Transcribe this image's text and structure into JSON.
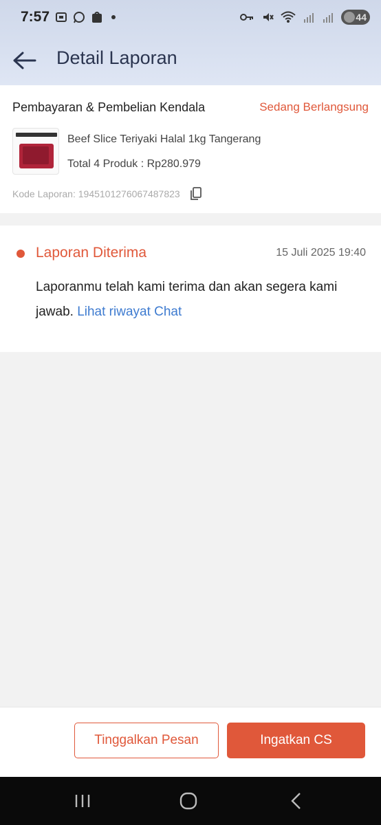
{
  "status_bar": {
    "time": "7:57",
    "battery": "44"
  },
  "header": {
    "title": "Detail Laporan"
  },
  "report": {
    "category": "Pembayaran & Pembelian Kendala",
    "status": "Sedang Berlangsung",
    "product_name": "Beef Slice Teriyaki Halal 1kg Tangerang",
    "total": "Total 4 Produk : Rp280.979",
    "code": "Kode Laporan: 1945101276067487823"
  },
  "timeline": {
    "title": "Laporan Diterima",
    "date": "15 Juli 2025 19:40",
    "message": "Laporanmu telah kami terima dan akan segera kami jawab.",
    "link": "Lihat riwayat Chat"
  },
  "actions": {
    "secondary_label": "Tinggalkan Pesan",
    "primary_label": "Ingatkan CS"
  },
  "colors": {
    "accent": "#e0583a",
    "link": "#3e7bd0",
    "header_bg": "#d8e0f0"
  },
  "icons": [
    "back-arrow-icon",
    "copy-icon",
    "recents-icon",
    "home-icon",
    "nav-back-icon"
  ]
}
